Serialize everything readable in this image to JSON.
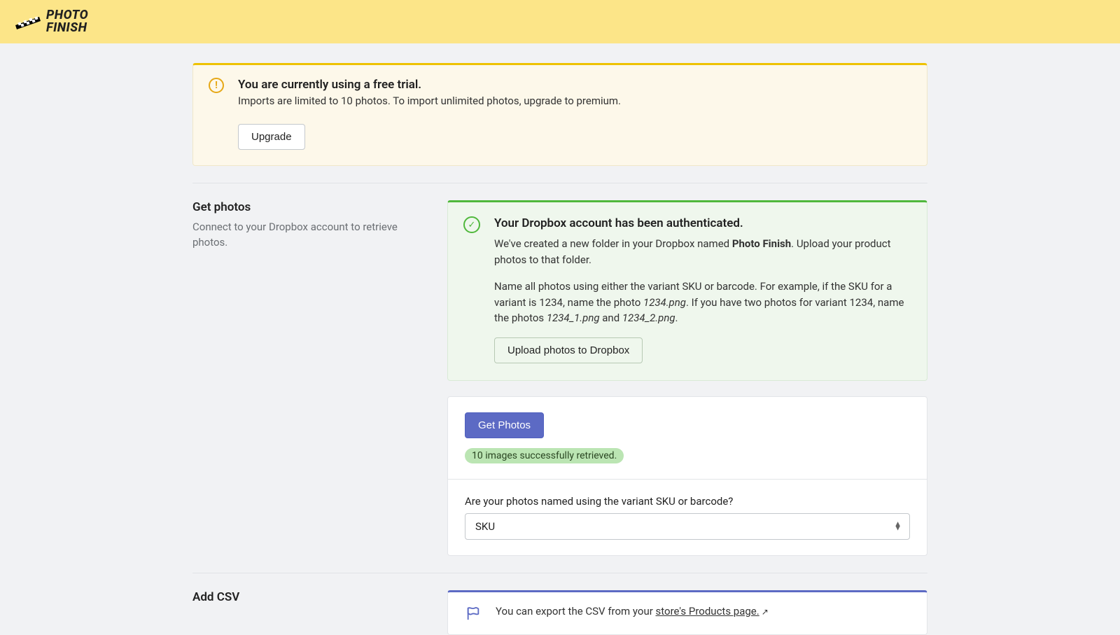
{
  "brand": {
    "name_line1": "PHOTO",
    "name_line2": "FINISH"
  },
  "trial": {
    "heading": "You are currently using a free trial.",
    "subtext": "Imports are limited to 10 photos. To import unlimited photos, upgrade to premium.",
    "upgrade_label": "Upgrade"
  },
  "get_photos": {
    "title": "Get photos",
    "desc": "Connect to your Dropbox account to retrieve photos."
  },
  "dropbox": {
    "heading": "Your Dropbox account has been authenticated.",
    "p1_a": "We've created a new folder in your Dropbox named ",
    "p1_bold": "Photo Finish",
    "p1_b": ". Upload your product photos to that folder.",
    "p2_a": "Name all photos using either the variant SKU or barcode. For example, if the SKU for a variant is 1234, name the photo ",
    "p2_em1": "1234.png",
    "p2_b": ". If you have two photos for variant 1234, name the photos ",
    "p2_em2": "1234_1.png",
    "p2_and": " and ",
    "p2_em3": "1234_2.png",
    "p2_end": ".",
    "upload_label": "Upload photos to Dropbox"
  },
  "retrieve": {
    "button_label": "Get Photos",
    "badge": "10 images successfully retrieved."
  },
  "naming": {
    "question": "Are your photos named using the variant SKU or barcode?",
    "selected": "SKU"
  },
  "csv": {
    "title": "Add CSV",
    "text_a": "You can export the CSV from your ",
    "link": "store's Products page."
  }
}
